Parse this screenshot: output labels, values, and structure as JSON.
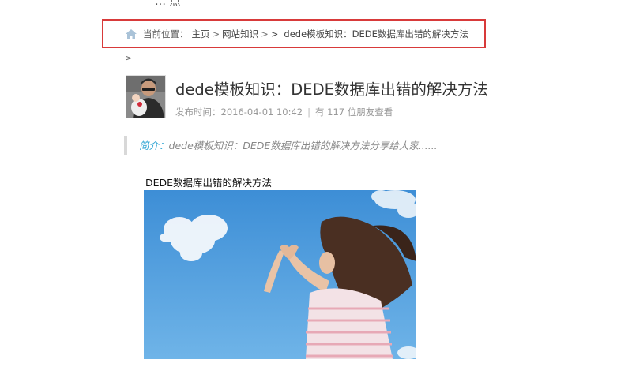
{
  "top_fragment": "… 点",
  "breadcrumb": {
    "prefix": "当前位置：",
    "items": [
      "主页",
      "网站知识",
      ">",
      "dede模板知识：DEDE数据库出错的解决方法"
    ],
    "separator": ">",
    "trailing": ">"
  },
  "post": {
    "title": "dede模板知识：DEDE数据库出错的解决方法",
    "published_label": "发布时间：2016-04-01 10:42",
    "views_prefix": "有",
    "views_count": "117",
    "views_suffix": "位朋友查看"
  },
  "intro": {
    "label": "简介：",
    "text": "dede模板知识：DEDE数据库出错的解决方法分享给大家......"
  },
  "content": {
    "heading": "DEDE数据库出错的解决方法"
  },
  "colors": {
    "highlight_border": "#d83a3a",
    "intro_label": "#2aa3d3",
    "sky": "#3f8fd4"
  }
}
